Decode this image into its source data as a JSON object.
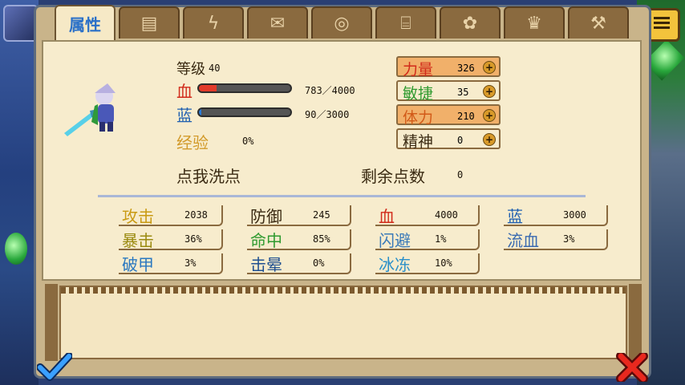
{
  "tabs": [
    {
      "label": "属性",
      "icon": "attributes-tab"
    },
    {
      "label": "",
      "icon": "chest-icon"
    },
    {
      "label": "",
      "icon": "lightning-icon"
    },
    {
      "label": "",
      "icon": "scroll-icon"
    },
    {
      "label": "",
      "icon": "compass-icon"
    },
    {
      "label": "",
      "icon": "barrel-icon"
    },
    {
      "label": "",
      "icon": "potion-icon"
    },
    {
      "label": "",
      "icon": "crown-icon"
    },
    {
      "label": "",
      "icon": "tools-icon"
    }
  ],
  "character": {
    "level_label": "等级",
    "level_value": "40",
    "hp_label": "血",
    "hp_text": "783／4000",
    "hp_fraction": 0.196,
    "mp_label": "蓝",
    "mp_text": "90／3000",
    "mp_fraction": 0.03,
    "exp_label": "经验",
    "exp_text": "0%",
    "reset_label": "点我洗点",
    "remaining_label": "剩余点数",
    "remaining_value": "0"
  },
  "attributes": [
    {
      "name": "力量",
      "value": "326",
      "color": "#d12a1a",
      "highlight": true
    },
    {
      "name": "敏捷",
      "value": "35",
      "color": "#2f9a2f",
      "highlight": false
    },
    {
      "name": "体力",
      "value": "210",
      "color": "#d25a18",
      "highlight": true
    },
    {
      "name": "精神",
      "value": "0",
      "color": "#3a2a12",
      "highlight": false
    }
  ],
  "stats": [
    {
      "name": "攻击",
      "value": "2038",
      "color": "#c99a12"
    },
    {
      "name": "防御",
      "value": "245",
      "color": "#3a2a12"
    },
    {
      "name": "血",
      "value": "4000",
      "color": "#d12a1a"
    },
    {
      "name": "蓝",
      "value": "3000",
      "color": "#1f5fb0"
    },
    {
      "name": "暴击",
      "value": "36%",
      "color": "#9a8a10"
    },
    {
      "name": "命中",
      "value": "85%",
      "color": "#2f9a2f"
    },
    {
      "name": "闪避",
      "value": "1%",
      "color": "#3a7ab8"
    },
    {
      "name": "流血",
      "value": "3%",
      "color": "#3a6ab0"
    },
    {
      "name": "破甲",
      "value": "3%",
      "color": "#2a78c0"
    },
    {
      "name": "击晕",
      "value": "0%",
      "color": "#1f4f90"
    },
    {
      "name": "冰冻",
      "value": "10%",
      "color": "#2a8fc8"
    }
  ],
  "colors": {
    "hp": "#e23b2b",
    "mp": "#2a7bd8"
  }
}
